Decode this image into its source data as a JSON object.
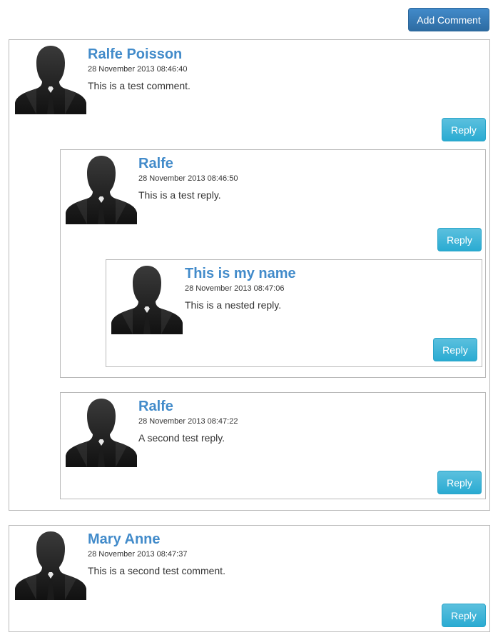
{
  "toolbar": {
    "add_comment_label": "Add Comment"
  },
  "comments": [
    {
      "name": "Ralfe Poisson",
      "date": "28 November 2013 08:46:40",
      "text": "This is a test comment.",
      "reply_label": "Reply",
      "avatar_icon": "user-silhouette-icon",
      "replies": [
        {
          "name": "Ralfe",
          "date": "28 November 2013 08:46:50",
          "text": "This is a test reply.",
          "reply_label": "Reply",
          "avatar_icon": "user-silhouette-icon",
          "replies": [
            {
              "name": "This is my name",
              "date": "28 November 2013 08:47:06",
              "text": "This is a nested reply.",
              "reply_label": "Reply",
              "avatar_icon": "user-silhouette-icon"
            }
          ]
        },
        {
          "name": "Ralfe",
          "date": "28 November 2013 08:47:22",
          "text": "A second test reply.",
          "reply_label": "Reply",
          "avatar_icon": "user-silhouette-icon"
        }
      ]
    },
    {
      "name": "Mary Anne",
      "date": "28 November 2013 08:47:37",
      "text": "This is a second test comment.",
      "reply_label": "Reply",
      "avatar_icon": "user-silhouette-icon"
    }
  ],
  "colors": {
    "name": "#428bca",
    "primary_button": "#337ab7",
    "info_button": "#39b3d7",
    "border": "#b9b9b9"
  }
}
